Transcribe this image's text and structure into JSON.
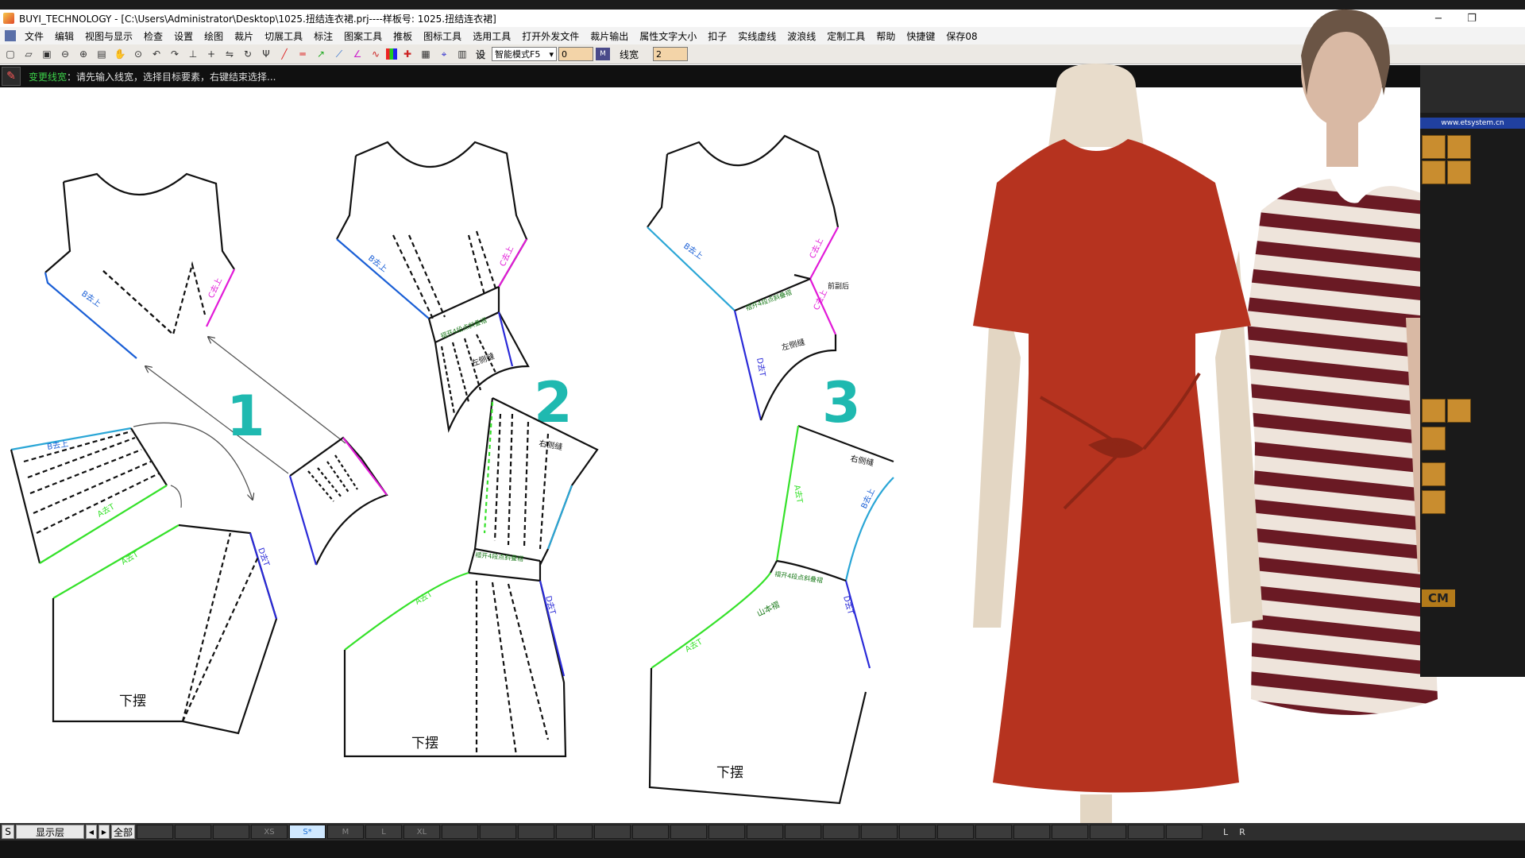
{
  "window": {
    "title": "BUYI_TECHNOLOGY - [C:\\Users\\Administrator\\Desktop\\1025.扭结连衣裙.prj----样板号: 1025.扭结连衣裙]",
    "minimize": "−",
    "restore": "❐",
    "close": "✕",
    "mdi_restore": "▭",
    "mdi_close": "✕"
  },
  "menu": [
    "文件",
    "编辑",
    "视图与显示",
    "检查",
    "设置",
    "绘图",
    "裁片",
    "切展工具",
    "标注",
    "图案工具",
    "推板",
    "图标工具",
    "选用工具",
    "打开外发文件",
    "裁片输出",
    "属性文字大小",
    "扣子",
    "实线虚线",
    "波浪线",
    "定制工具",
    "帮助",
    "快捷键",
    "保存08"
  ],
  "toolbar": {
    "mode_select": "智能模式F5",
    "value_field": "0",
    "line_width_label": "线宽",
    "line_width_value": "2"
  },
  "status": {
    "command": "变更线宽",
    "prompt": "：请先输入线宽，选择目标要素，右键结束选择..."
  },
  "pattern": {
    "step_numbers": [
      "1",
      "2",
      "3"
    ],
    "hem_label": "下摆",
    "side_seam_label": "右侧缝",
    "left_side_label": "左侧缝",
    "front_label": "前副后",
    "fold_label": "褶开4段点斜叠褶",
    "mountain_fold_label": "山本褶",
    "mark_A": "A去T",
    "mark_B": "B去上",
    "mark_C": "C去上",
    "mark_D": "D去T"
  },
  "right_panel": {
    "website": "www.etsystem.cn",
    "unit": "CM"
  },
  "bottom": {
    "s_button": "S",
    "layer_button": "显示层",
    "prev": "◀",
    "next": "▶",
    "all_button": "全部",
    "sizes": [
      "XS",
      "S*",
      "M",
      "L",
      "XL"
    ],
    "right_letters": [
      "L",
      "R"
    ]
  },
  "colors": {
    "blue_line": "#1a5fd6",
    "magenta_line": "#e21ad8",
    "green_line": "#35e12a",
    "cyan_line": "#2aa6d6",
    "teal_number": "#1fb9b0",
    "red_dress": "#b6331f"
  }
}
